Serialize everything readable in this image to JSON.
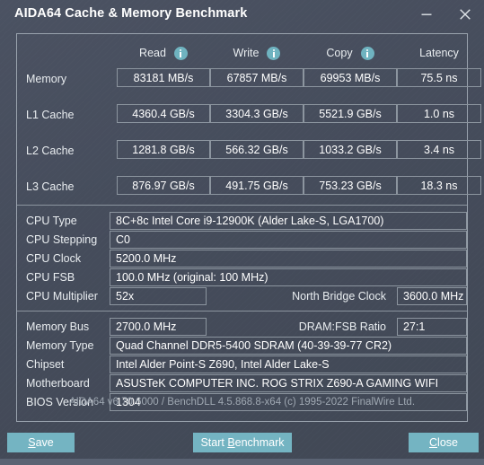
{
  "window": {
    "title": "AIDA64 Cache & Memory Benchmark",
    "minimize_label": "minimize",
    "close_label": "close"
  },
  "benchmark": {
    "columns": [
      {
        "label": "Read",
        "has_info": true
      },
      {
        "label": "Write",
        "has_info": true
      },
      {
        "label": "Copy",
        "has_info": true
      },
      {
        "label": "Latency",
        "has_info": false
      }
    ],
    "rows": [
      {
        "label": "Memory",
        "read": "83181 MB/s",
        "write": "67857 MB/s",
        "copy": "69953 MB/s",
        "latency": "75.5 ns"
      },
      {
        "label": "L1 Cache",
        "read": "4360.4 GB/s",
        "write": "3304.3 GB/s",
        "copy": "5521.9 GB/s",
        "latency": "1.0 ns"
      },
      {
        "label": "L2 Cache",
        "read": "1281.8 GB/s",
        "write": "566.32 GB/s",
        "copy": "1033.2 GB/s",
        "latency": "3.4 ns"
      },
      {
        "label": "L3 Cache",
        "read": "876.97 GB/s",
        "write": "491.75 GB/s",
        "copy": "753.23 GB/s",
        "latency": "18.3 ns"
      }
    ]
  },
  "cpu_info": {
    "cpu_type_label": "CPU Type",
    "cpu_type_value": "8C+8c Intel Core i9-12900K  (Alder Lake-S, LGA1700)",
    "cpu_stepping_label": "CPU Stepping",
    "cpu_stepping_value": "C0",
    "cpu_clock_label": "CPU Clock",
    "cpu_clock_value": "5200.0 MHz",
    "cpu_fsb_label": "CPU FSB",
    "cpu_fsb_value": "100.0 MHz  (original: 100 MHz)",
    "cpu_multiplier_label": "CPU Multiplier",
    "cpu_multiplier_value": "52x",
    "north_bridge_clock_label": "North Bridge Clock",
    "north_bridge_clock_value": "3600.0 MHz"
  },
  "memory_info": {
    "memory_bus_label": "Memory Bus",
    "memory_bus_value": "2700.0 MHz",
    "dram_fsb_ratio_label": "DRAM:FSB Ratio",
    "dram_fsb_ratio_value": "27:1",
    "memory_type_label": "Memory Type",
    "memory_type_value": "Quad Channel DDR5-5400 SDRAM  (40-39-39-77 CR2)",
    "chipset_label": "Chipset",
    "chipset_value": "Intel Alder Point-S Z690, Intel Alder Lake-S",
    "motherboard_label": "Motherboard",
    "motherboard_value": "ASUSTeK COMPUTER INC. ROG STRIX Z690-A GAMING WIFI",
    "bios_version_label": "BIOS Version",
    "bios_version_value": "1304"
  },
  "copyright": "AIDA64 v6.70.6000 / BenchDLL 4.5.868.8-x64  (c) 1995-2022 FinalWire Ltd.",
  "buttons": {
    "save": {
      "prefix": "",
      "accel": "S",
      "suffix": "ave"
    },
    "start_benchmark": {
      "prefix": "Start ",
      "accel": "B",
      "suffix": "enchmark"
    },
    "close": {
      "prefix": "",
      "accel": "C",
      "suffix": "lose"
    }
  },
  "colors": {
    "accent": "#74b4c2",
    "window_bg": "#474f5e",
    "border": "#8c959f",
    "text": "#e8ecef"
  }
}
